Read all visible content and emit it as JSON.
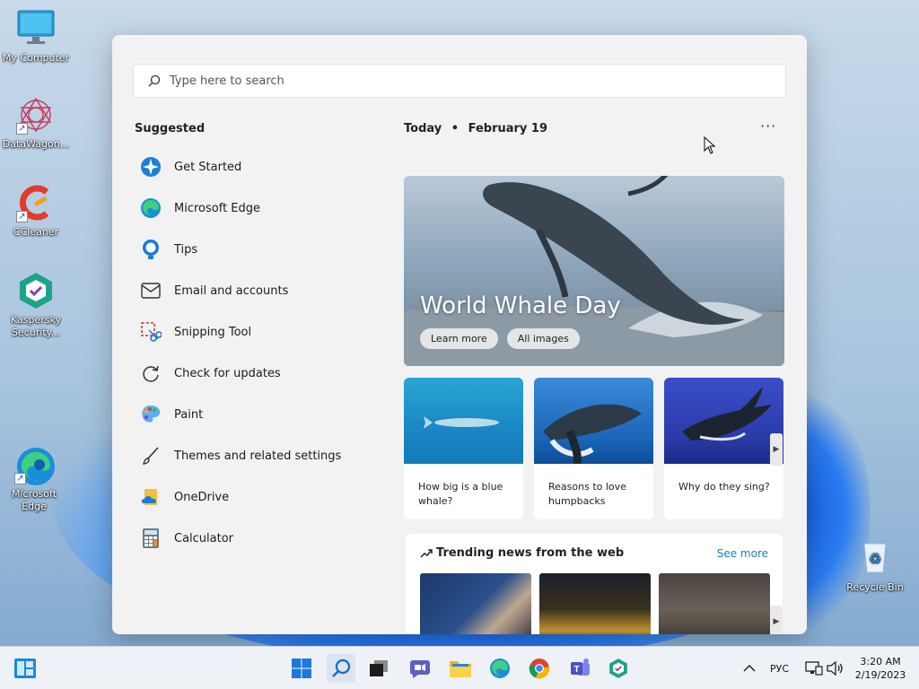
{
  "desktop": {
    "icons": [
      {
        "label": "My Computer"
      },
      {
        "label": "DataWagon..."
      },
      {
        "label": "CCleaner"
      },
      {
        "label": "Kaspersky Security..."
      },
      {
        "label": "Microsoft Edge"
      },
      {
        "label": "Recycle Bin"
      }
    ]
  },
  "search": {
    "placeholder": "Type here to search"
  },
  "suggested": {
    "title": "Suggested",
    "items": [
      {
        "label": "Get Started",
        "icon": "get-started-icon"
      },
      {
        "label": "Microsoft Edge",
        "icon": "edge-icon"
      },
      {
        "label": "Tips",
        "icon": "tips-icon"
      },
      {
        "label": "Email and accounts",
        "icon": "mail-icon"
      },
      {
        "label": "Snipping Tool",
        "icon": "snipping-tool-icon"
      },
      {
        "label": "Check for updates",
        "icon": "refresh-icon"
      },
      {
        "label": "Paint",
        "icon": "paint-icon"
      },
      {
        "label": "Themes and related settings",
        "icon": "brush-icon"
      },
      {
        "label": "OneDrive",
        "icon": "onedrive-icon"
      },
      {
        "label": "Calculator",
        "icon": "calculator-icon"
      }
    ]
  },
  "today": {
    "label": "Today",
    "separator": "•",
    "date": "February 19",
    "more": "···"
  },
  "hero": {
    "title": "World Whale Day",
    "learn_more": "Learn more",
    "all_images": "All images"
  },
  "cards": [
    {
      "caption": "How big is a blue whale?"
    },
    {
      "caption": "Reasons to love humpbacks"
    },
    {
      "caption": "Why do they sing?"
    }
  ],
  "trending": {
    "title": "Trending news from the web",
    "see_more": "See more"
  },
  "taskbar": {
    "lang": "РУС",
    "time": "3:20 AM",
    "date": "2/19/2023"
  }
}
